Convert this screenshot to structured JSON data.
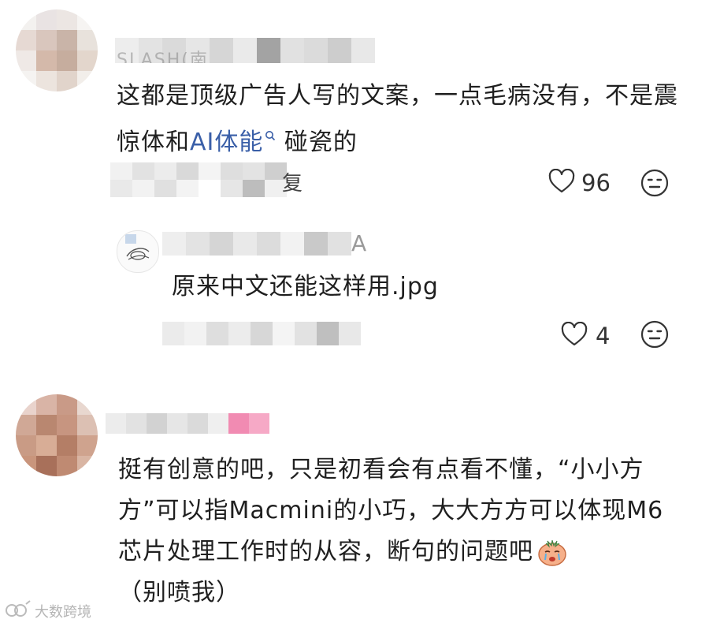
{
  "comments": [
    {
      "author_visible": "SLASH(南...",
      "text_before_link": "这都是顶级广告人写的文案，一点毛病没有，不是震惊体和",
      "link_text": "AI体能",
      "text_after_link": "碰瓷的",
      "reply_label_fragment": "复",
      "likes": "96",
      "reply": {
        "author_fragment": "A",
        "text": "原来中文还能这样用.jpg",
        "likes": "4"
      }
    },
    {
      "text": "挺有创意的吧，只是初看会有点看不懂，“小小方方”可以指Macmini的小巧，大大方方可以体现M6芯片处理工作时的从容，断句的问题吧",
      "text_tail": "（别喷我）"
    }
  ],
  "watermark": "大数跨境",
  "icons": {
    "like": "heart-outline-icon",
    "react": "neutral-face-icon",
    "search": "search-icon",
    "emoji": "crying-face-emoji-icon"
  },
  "colors": {
    "link": "#3a5fa8",
    "text": "#1f1f1f",
    "icon": "#333333"
  }
}
